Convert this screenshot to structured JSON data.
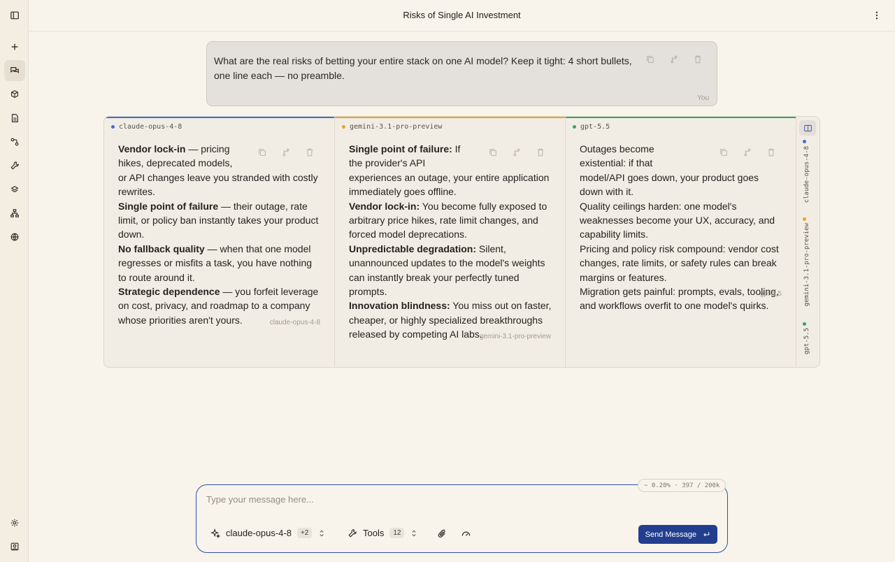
{
  "header": {
    "title": "Risks of Single AI Investment"
  },
  "rail": {
    "items": [
      "sidebar-toggle-icon",
      "new-chat-icon",
      "chats-icon",
      "models-icon",
      "documents-icon",
      "workflows-icon",
      "tools-icon",
      "prompts-icon",
      "agents-icon",
      "web-icon",
      "settings-icon",
      "account-icon"
    ]
  },
  "user_message": {
    "text": "What are the real risks of betting your entire stack on one AI model? Keep it tight: 4 short bullets, one line each — no preamble.",
    "author": "You"
  },
  "responses": [
    {
      "model": "claude-opus-4-8",
      "color": "#3b6fd8",
      "paragraphs": [
        {
          "bold": "Vendor lock-in",
          "rest": " — pricing hikes, deprecated models, or API changes leave you stranded with costly rewrites."
        },
        {
          "bold": "Single point of failure",
          "rest": " — their outage, rate limit, or policy ban instantly takes your product down."
        },
        {
          "bold": "No fallback quality",
          "rest": " — when that one model regresses or misfits a task, you have nothing to route around it."
        },
        {
          "bold": "Strategic dependence",
          "rest": " — you forfeit leverage on cost, privacy, and roadmap to a company whose priorities aren't yours."
        }
      ],
      "footer": "claude-opus-4-8"
    },
    {
      "model": "gemini-3.1-pro-preview",
      "color": "#e7a328",
      "paragraphs": [
        {
          "bold": "Single point of failure:",
          "rest": " If the provider's API experiences an outage, your entire application immediately goes offline."
        },
        {
          "bold": "Vendor lock-in:",
          "rest": " You become fully exposed to arbitrary price hikes, rate limit changes, and forced model deprecations."
        },
        {
          "bold": "Unpredictable degradation:",
          "rest": " Silent, unannounced updates to the model's weights can instantly break your perfectly tuned prompts."
        },
        {
          "bold": "Innovation blindness:",
          "rest": " You miss out on faster, cheaper, or highly specialized breakthroughs released by competing AI labs."
        }
      ],
      "footer": "gemini-3.1-pro-preview"
    },
    {
      "model": "gpt-5.5",
      "color": "#2fa860",
      "paragraphs": [
        {
          "bold": "",
          "rest": "Outages become existential: if that model/API goes down, your product goes down with it."
        },
        {
          "bold": "",
          "rest": "Quality ceilings harden: one model's weaknesses become your UX, accuracy, and capability limits."
        },
        {
          "bold": "",
          "rest": "Pricing and policy risk compound: vendor cost changes, rate limits, or safety rules can break margins or features."
        },
        {
          "bold": "",
          "rest": "Migration gets painful: prompts, evals, tooling, and workflows overfit to one model's quirks."
        }
      ],
      "footer": "gpt-5.5"
    }
  ],
  "side_strip": {
    "labels": [
      "claude-opus-4-8",
      "gemini-3.1-pro-preview",
      "gpt-5.5"
    ]
  },
  "composer": {
    "placeholder": "Type your message here...",
    "context": "~ 0.20% · 397 / 200k",
    "model": "claude-opus-4-8",
    "model_extra": "+2",
    "tools_label": "Tools",
    "tools_count": "12",
    "send_label": "Send Message"
  }
}
